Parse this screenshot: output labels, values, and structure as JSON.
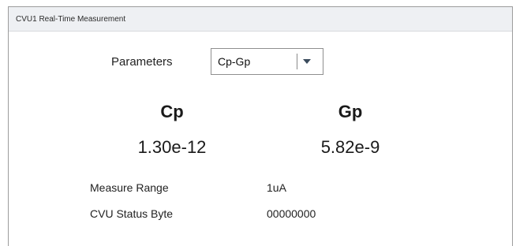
{
  "window": {
    "title": "CVU1 Real-Time Measurement"
  },
  "parameters": {
    "label": "Parameters",
    "selected": "Cp-Gp"
  },
  "measurements": [
    {
      "name": "Cp",
      "value": "1.30e-12"
    },
    {
      "name": "Gp",
      "value": "5.82e-9"
    }
  ],
  "info": {
    "measure_range_label": "Measure Range",
    "measure_range_value": "1uA",
    "status_byte_label": "CVU Status Byte",
    "status_byte_value": "00000000"
  }
}
